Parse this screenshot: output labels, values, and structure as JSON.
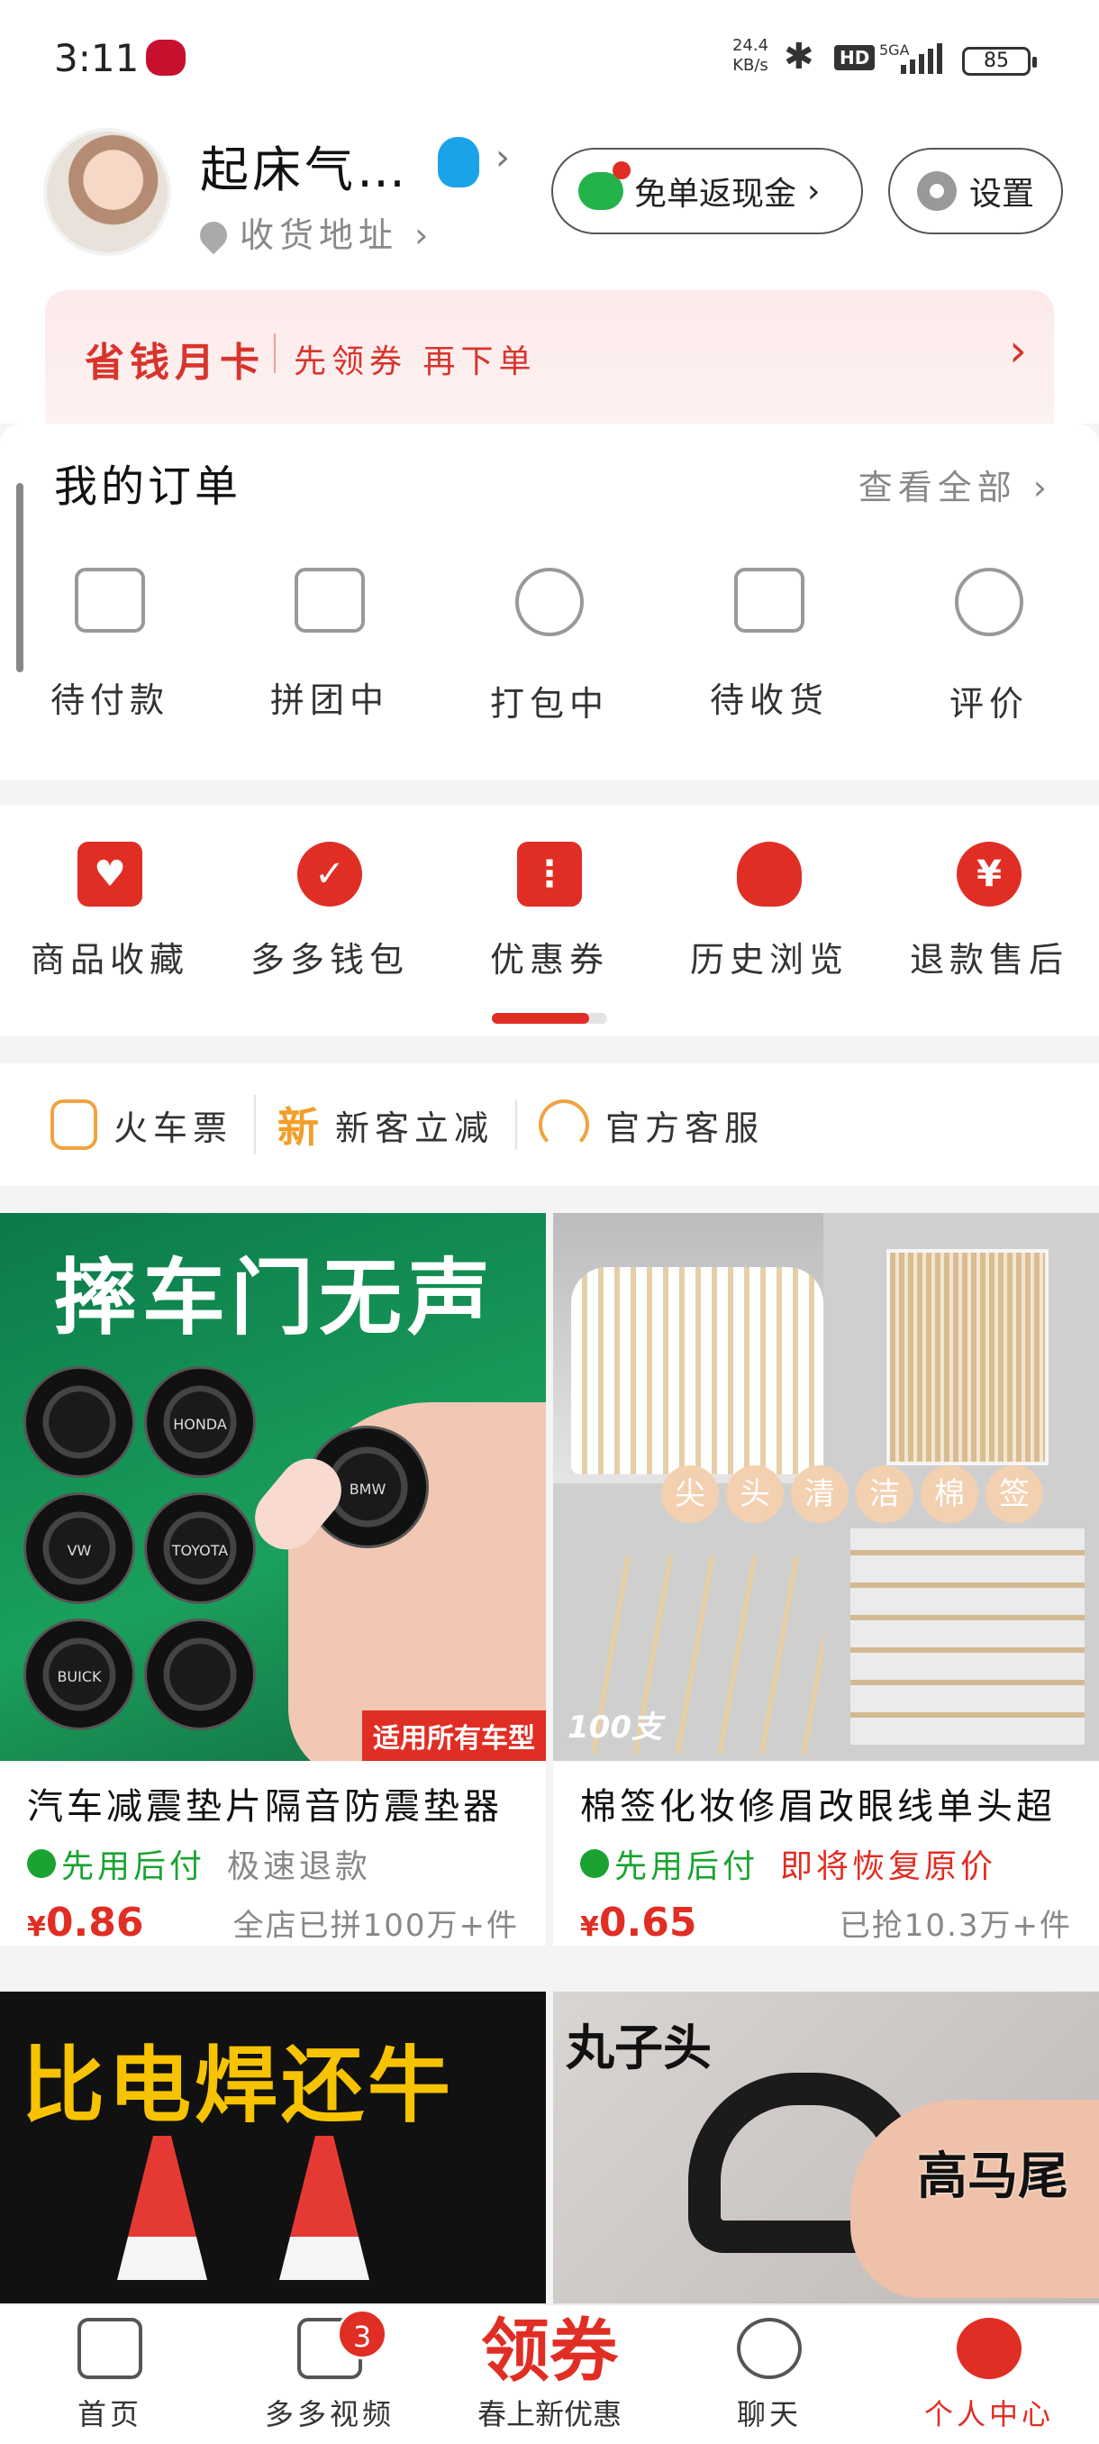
{
  "status_bar": {
    "time": "3:11",
    "net_speed": "24.4 KB/s",
    "hd": "HD",
    "network": "5GA",
    "battery": "85"
  },
  "profile": {
    "nickname": "起床气…",
    "address_label": "收货地址",
    "cashback_button": "免单返现金",
    "settings_button": "设置"
  },
  "banner": {
    "title": "省钱月卡",
    "subtitle": "先领券 再下单"
  },
  "orders": {
    "title": "我的订单",
    "view_all": "查看全部",
    "items": [
      {
        "label": "待付款",
        "icon": "wallet-icon"
      },
      {
        "label": "拼团中",
        "icon": "share-box-icon"
      },
      {
        "label": "打包中",
        "icon": "clock-icon"
      },
      {
        "label": "待收货",
        "icon": "truck-icon"
      },
      {
        "label": "评价",
        "icon": "star-icon"
      }
    ]
  },
  "tools": {
    "items": [
      {
        "label": "商品收藏",
        "icon": "bag-heart-icon"
      },
      {
        "label": "多多钱包",
        "icon": "wallet-heart-icon"
      },
      {
        "label": "优惠券",
        "icon": "ticket-icon"
      },
      {
        "label": "历史浏览",
        "icon": "footprint-icon"
      },
      {
        "label": "退款售后",
        "icon": "yen-icon",
        "glyph": "¥"
      }
    ]
  },
  "quick_links": {
    "train": "火车票",
    "new_icon": "新",
    "new_user": "新客立减",
    "service": "官方客服"
  },
  "products": [
    {
      "image_text": "摔车门无声",
      "image_tag": "适用所有车型",
      "disc_labels": [
        "",
        "HONDA",
        "BMW",
        "VW",
        "TOYOTA",
        "BUICK",
        ""
      ],
      "name": "汽车减震垫片隔音防震垫器",
      "tag1": "先用后付",
      "tag2": "极速退款",
      "currency": "¥",
      "price": "0.86",
      "sold": "全店已拼100万+件"
    },
    {
      "image_text": "尖头清洁棉签",
      "image_tag": "100支",
      "name": "棉签化妆修眉改眼线单头超",
      "tag1": "先用后付",
      "tag2": "即将恢复原价",
      "currency": "¥",
      "price": "0.65",
      "sold": "已抢10.3万+件"
    },
    {
      "image_text": "比电焊还牛"
    },
    {
      "image_text": "丸子头",
      "image_text2": "高马尾"
    }
  ],
  "bottom_nav": {
    "home": "首页",
    "video": "多多视频",
    "video_badge": "3",
    "center_big": "领券",
    "center_sub": "春上新优惠",
    "chat": "聊天",
    "me": "个人中心"
  },
  "colors": {
    "brand_red": "#e02e24",
    "green_tag": "#1aa331"
  }
}
